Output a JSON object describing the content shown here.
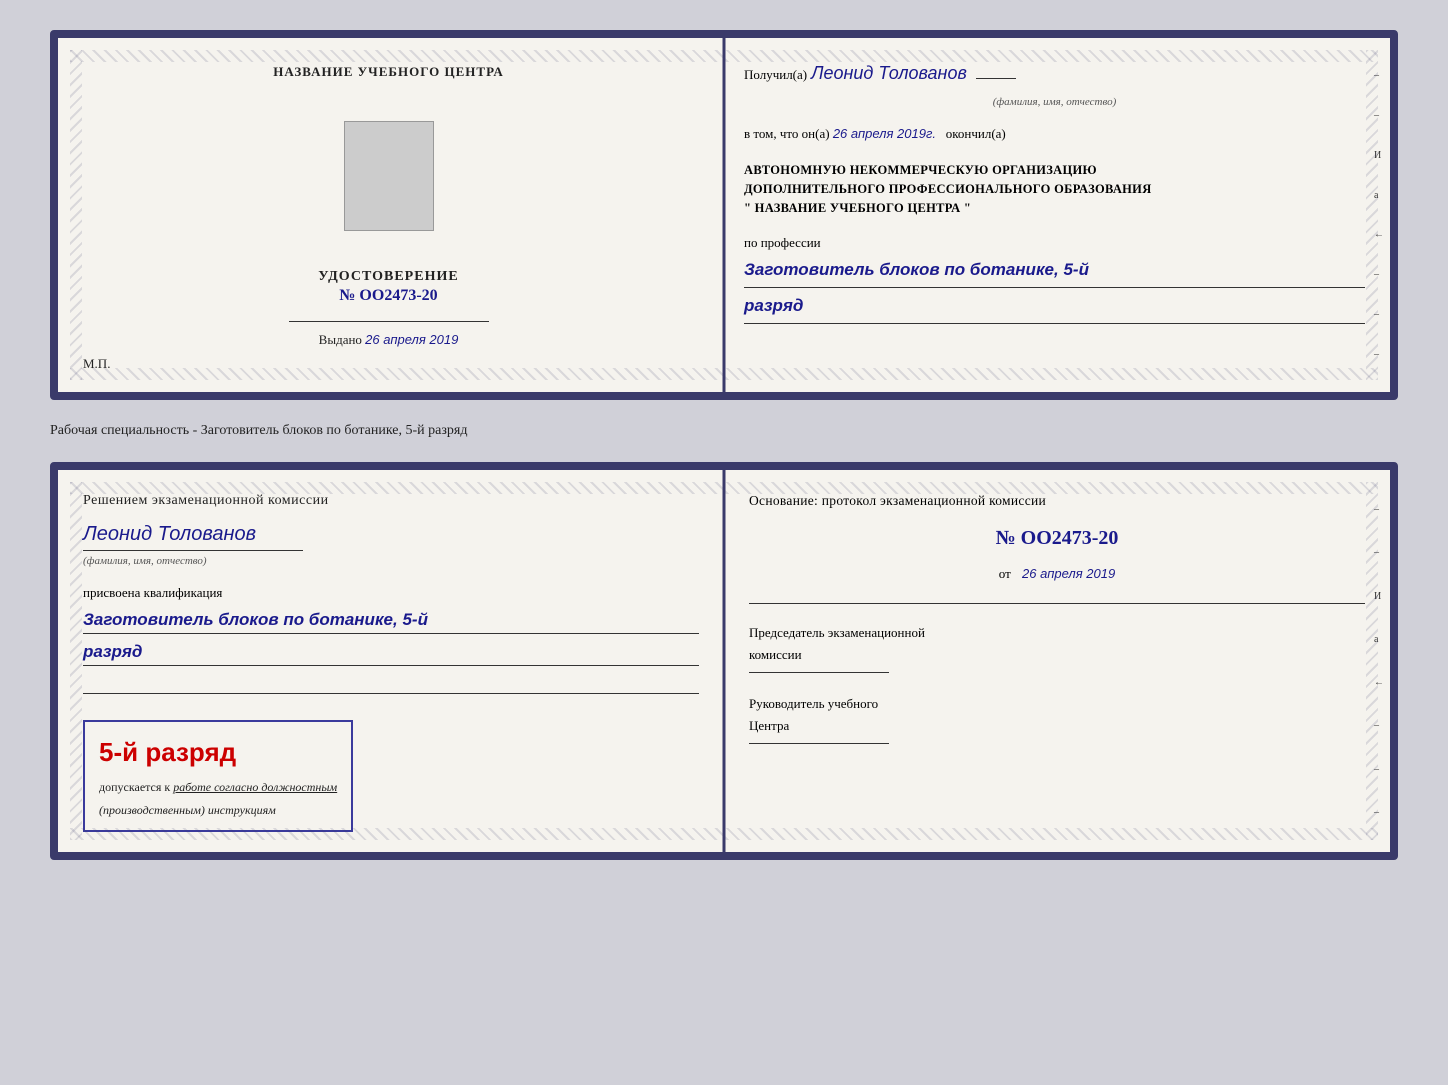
{
  "page": {
    "background_color": "#d0d0d8"
  },
  "top_document": {
    "left": {
      "section_title": "НАЗВАНИЕ УЧЕБНОГО ЦЕНТРА",
      "cert_label": "УДОСТОВЕРЕНИЕ",
      "cert_number_prefix": "№",
      "cert_number": "OO2473-20",
      "issued_label": "Выдано",
      "issued_date": "26 апреля 2019",
      "mp_label": "М.П."
    },
    "right": {
      "received_prefix": "Получил(а)",
      "received_name": "Леонид Толованов",
      "fio_label": "(фамилия, имя, отчество)",
      "completed_prefix": "в том, что он(а)",
      "completed_date": "26 апреля 2019г.",
      "completed_suffix": "окончил(а)",
      "org_line1": "АВТОНОМНУЮ НЕКОММЕРЧЕСКУЮ ОРГАНИЗАЦИЮ",
      "org_line2": "ДОПОЛНИТЕЛЬНОГО ПРОФЕССИОНАЛЬНОГО ОБРАЗОВАНИЯ",
      "org_line3": "\"  НАЗВАНИЕ УЧЕБНОГО ЦЕНТРА  \"",
      "profession_label": "по профессии",
      "profession_value": "Заготовитель блоков по ботанике, 5-й",
      "rank_value": "разряд"
    }
  },
  "separator": {
    "label": "Рабочая специальность - Заготовитель блоков по ботанике, 5-й разряд"
  },
  "bottom_document": {
    "left": {
      "decision_prefix": "Решением экзаменационной комиссии",
      "person_name": "Леонид Толованов",
      "fio_label": "(фамилия, имя, отчество)",
      "qualification_prefix": "присвоена квалификация",
      "qualification_value": "Заготовитель блоков по ботанике, 5-й",
      "rank_value": "разряд",
      "rank_box_number": "5-й разряд",
      "allowed_prefix": "допускается к",
      "allowed_text": "работе согласно должностным",
      "instructions_text": "(производственным) инструкциям"
    },
    "right": {
      "basis_label": "Основание: протокол экзаменационной комиссии",
      "protocol_number": "№  OO2473-20",
      "from_prefix": "от",
      "from_date": "26 апреля 2019",
      "chairman_label": "Председатель экзаменационной",
      "chairman_label2": "комиссии",
      "director_label": "Руководитель учебного",
      "director_label2": "Центра"
    }
  },
  "side_chars": [
    "–",
    "–",
    "И",
    "а",
    "←",
    "–",
    "–",
    "–"
  ]
}
